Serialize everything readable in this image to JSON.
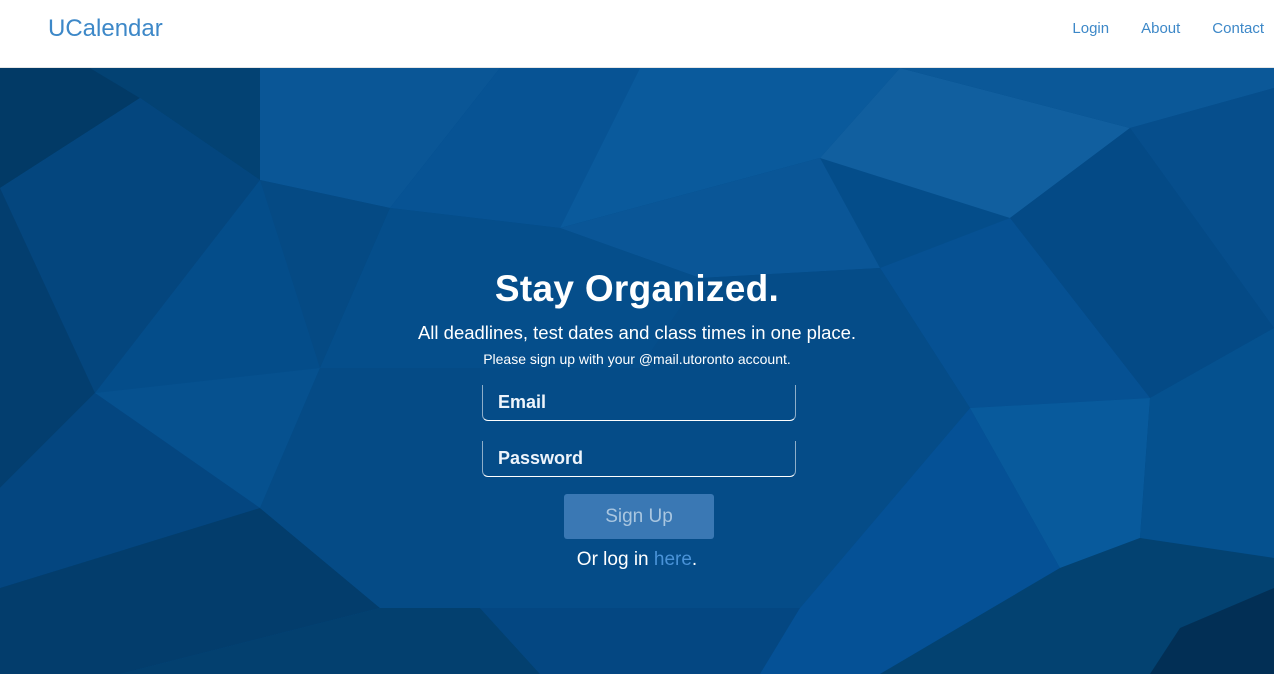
{
  "nav": {
    "brand": "UCalendar",
    "links": [
      "Login",
      "About",
      "Contact"
    ]
  },
  "hero": {
    "headline": "Stay Organized.",
    "tagline": "All deadlines, test dates and class times in one place.",
    "note": "Please sign up with your @mail.utoronto account."
  },
  "form": {
    "email_placeholder": "Email",
    "password_placeholder": "Password",
    "signup_label": "Sign Up",
    "login_prefix": "Or log in ",
    "login_link": "here",
    "login_suffix": "."
  },
  "colors": {
    "brand": "#3d88c8",
    "hero_bg": "#044d8a",
    "button_bg": "#3a78b4",
    "link": "#4a93d8"
  }
}
